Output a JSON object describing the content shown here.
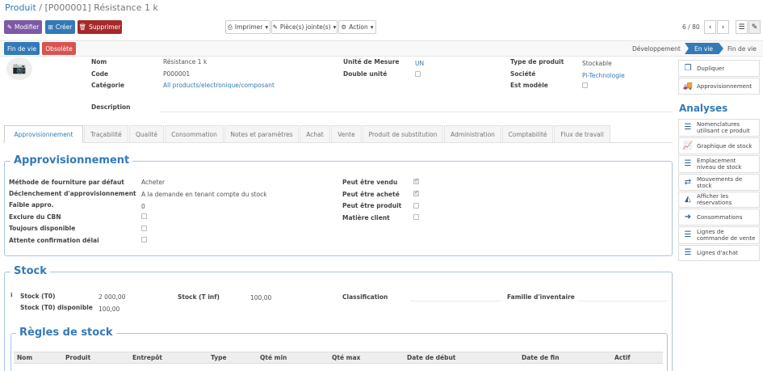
{
  "breadcrumb": {
    "root": "Produit",
    "separator": "/",
    "current": "[P000001] Résistance 1 k"
  },
  "toolbar": {
    "edit_label": "Modifier",
    "create_label": "Créer",
    "delete_label": "Supprimer",
    "print_label": "Imprimer",
    "attachments_label": "Pièce(s) jointe(s)",
    "action_label": "Action"
  },
  "pager": {
    "text": "6 / 80"
  },
  "header_buttons": {
    "end_of_life": "Fin de vie",
    "obsolete": "Obsolète"
  },
  "stages": [
    "Développement",
    "En vie",
    "Fin de vie"
  ],
  "active_stage": "En vie",
  "product": {
    "labels": {
      "name": "Nom",
      "code": "Code",
      "category": "Catégorie",
      "description": "Description",
      "uom": "Unité de Mesure",
      "double_unit": "Double unité",
      "product_type": "Type de produit",
      "company": "Société",
      "is_model": "Est modèle"
    },
    "name": "Résistance 1 k",
    "code": "P000001",
    "category": "All products/electronique/composant",
    "uom": "UN",
    "product_type": "Stockable",
    "company": "Pi-Technologie"
  },
  "tabs": [
    "Approvisionnement",
    "Traçabilité",
    "Qualité",
    "Consommation",
    "Notes et paramètres",
    "Achat",
    "Vente",
    "Produit de substitution",
    "Administration",
    "Comptabilité",
    "Flux de travail"
  ],
  "procurement": {
    "title": "Approvisionnement",
    "labels": {
      "supply_method": "Méthode de fourniture par défaut",
      "trigger": "Déclenchement d'approvisionnement",
      "low_procure": "Faible appro.",
      "exclude_cbn": "Exclure du CBN",
      "always_available": "Toujours disponible",
      "await_confirmation": "Attente confirmation délai",
      "can_sell": "Peut être vendu",
      "can_buy": "Peut être acheté",
      "can_produce": "Peut être produit",
      "raw_material": "Matière client"
    },
    "supply_method": "Acheter",
    "trigger": "A la demande en tenant compte du stock",
    "low_procure": "0"
  },
  "stock": {
    "title": "Stock",
    "labels": {
      "stock_t0": "Stock (T0)",
      "stock_t_inf": "Stock (T inf)",
      "classification": "Classification",
      "family": "Famille d'inventaire",
      "stock_t0_available": "Stock (T0) disponible"
    },
    "stock_t0": "2 000,00",
    "stock_t_inf": "100,00",
    "stock_t0_available": "100,00"
  },
  "stock_rules": {
    "title": "Règles de stock",
    "columns": [
      "Nom",
      "Produit",
      "Entrepôt",
      "Type",
      "Qté min",
      "Qté max",
      "Date de début",
      "Date de fin",
      "Actif"
    ]
  },
  "sidebar": {
    "top_buttons": [
      {
        "label": "Dupliquer",
        "icon": "copy-icon"
      },
      {
        "label": "Approvisionnement",
        "icon": "truck-icon"
      }
    ],
    "analyses_title": "Analyses",
    "analyses": [
      {
        "label": "Nomenclatures utilisant ce produit",
        "icon": "list-icon"
      },
      {
        "label": "Graphique de stock",
        "icon": "line-chart-icon"
      },
      {
        "label": "Emplacement niveau de stock",
        "icon": "list-icon"
      },
      {
        "label": "Mouvements de stock",
        "icon": "exchange-icon"
      },
      {
        "label": "Afficher les réservations",
        "icon": "area-chart-icon"
      },
      {
        "label": "Consommations",
        "icon": "sign-out-icon"
      },
      {
        "label": "Lignes de commande de vente",
        "icon": "list-icon"
      },
      {
        "label": "Lignes d'achat",
        "icon": "list-icon"
      }
    ]
  }
}
